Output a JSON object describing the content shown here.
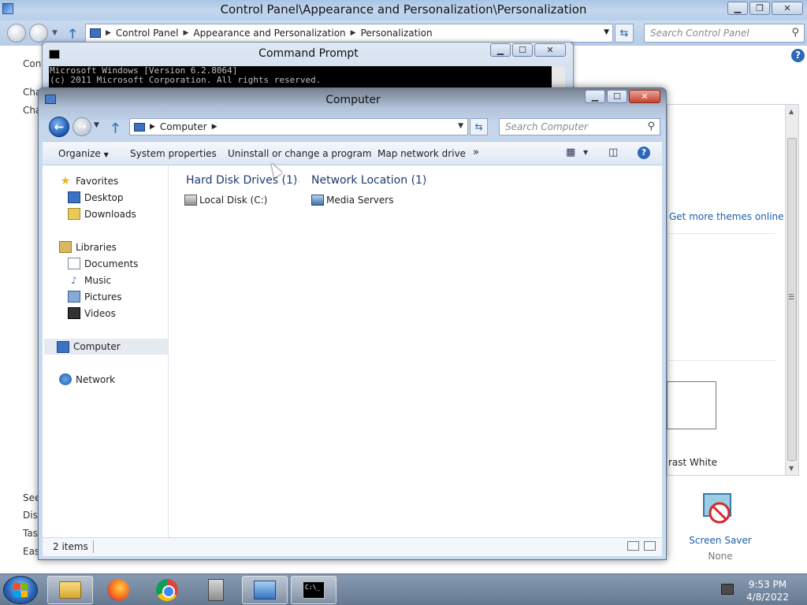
{
  "control_panel": {
    "title": "Control Panel\\Appearance and Personalization\\Personalization",
    "breadcrumbs": [
      "Control Panel",
      "Appearance and Personalization",
      "Personalization"
    ],
    "search_placeholder": "Search Control Panel",
    "left_texts": [
      "Cont",
      "Cha",
      "Cha",
      "See",
      "Disp",
      "Tas",
      "Eas"
    ],
    "get_more_themes": "Get more themes online",
    "contrast_label": "rast White",
    "screen_saver_label": "Screen Saver",
    "screen_saver_value": "None"
  },
  "cmd": {
    "title": "Command Prompt",
    "lines": [
      "Microsoft Windows [Version 6.2.8064]",
      "(c) 2011 Microsoft Corporation. All rights reserved."
    ]
  },
  "explorer": {
    "title": "Computer",
    "address": "Computer",
    "search_placeholder": "Search Computer",
    "toolbar": {
      "organize": "Organize",
      "system_properties": "System properties",
      "uninstall": "Uninstall or change a program",
      "map_drive": "Map network drive",
      "more": "»"
    },
    "nav": {
      "favorites": "Favorites",
      "desktop": "Desktop",
      "downloads": "Downloads",
      "libraries": "Libraries",
      "documents": "Documents",
      "music": "Music",
      "pictures": "Pictures",
      "videos": "Videos",
      "computer": "Computer",
      "network": "Network"
    },
    "groups": {
      "hard_disks": "Hard Disk Drives (1)",
      "network_location": "Network Location (1)"
    },
    "items": {
      "local_disk": "Local Disk (C:)",
      "media_servers": "Media Servers"
    },
    "status": "2 items"
  },
  "taskbar": {
    "time": "9:53 PM",
    "date": "4/8/2022"
  }
}
